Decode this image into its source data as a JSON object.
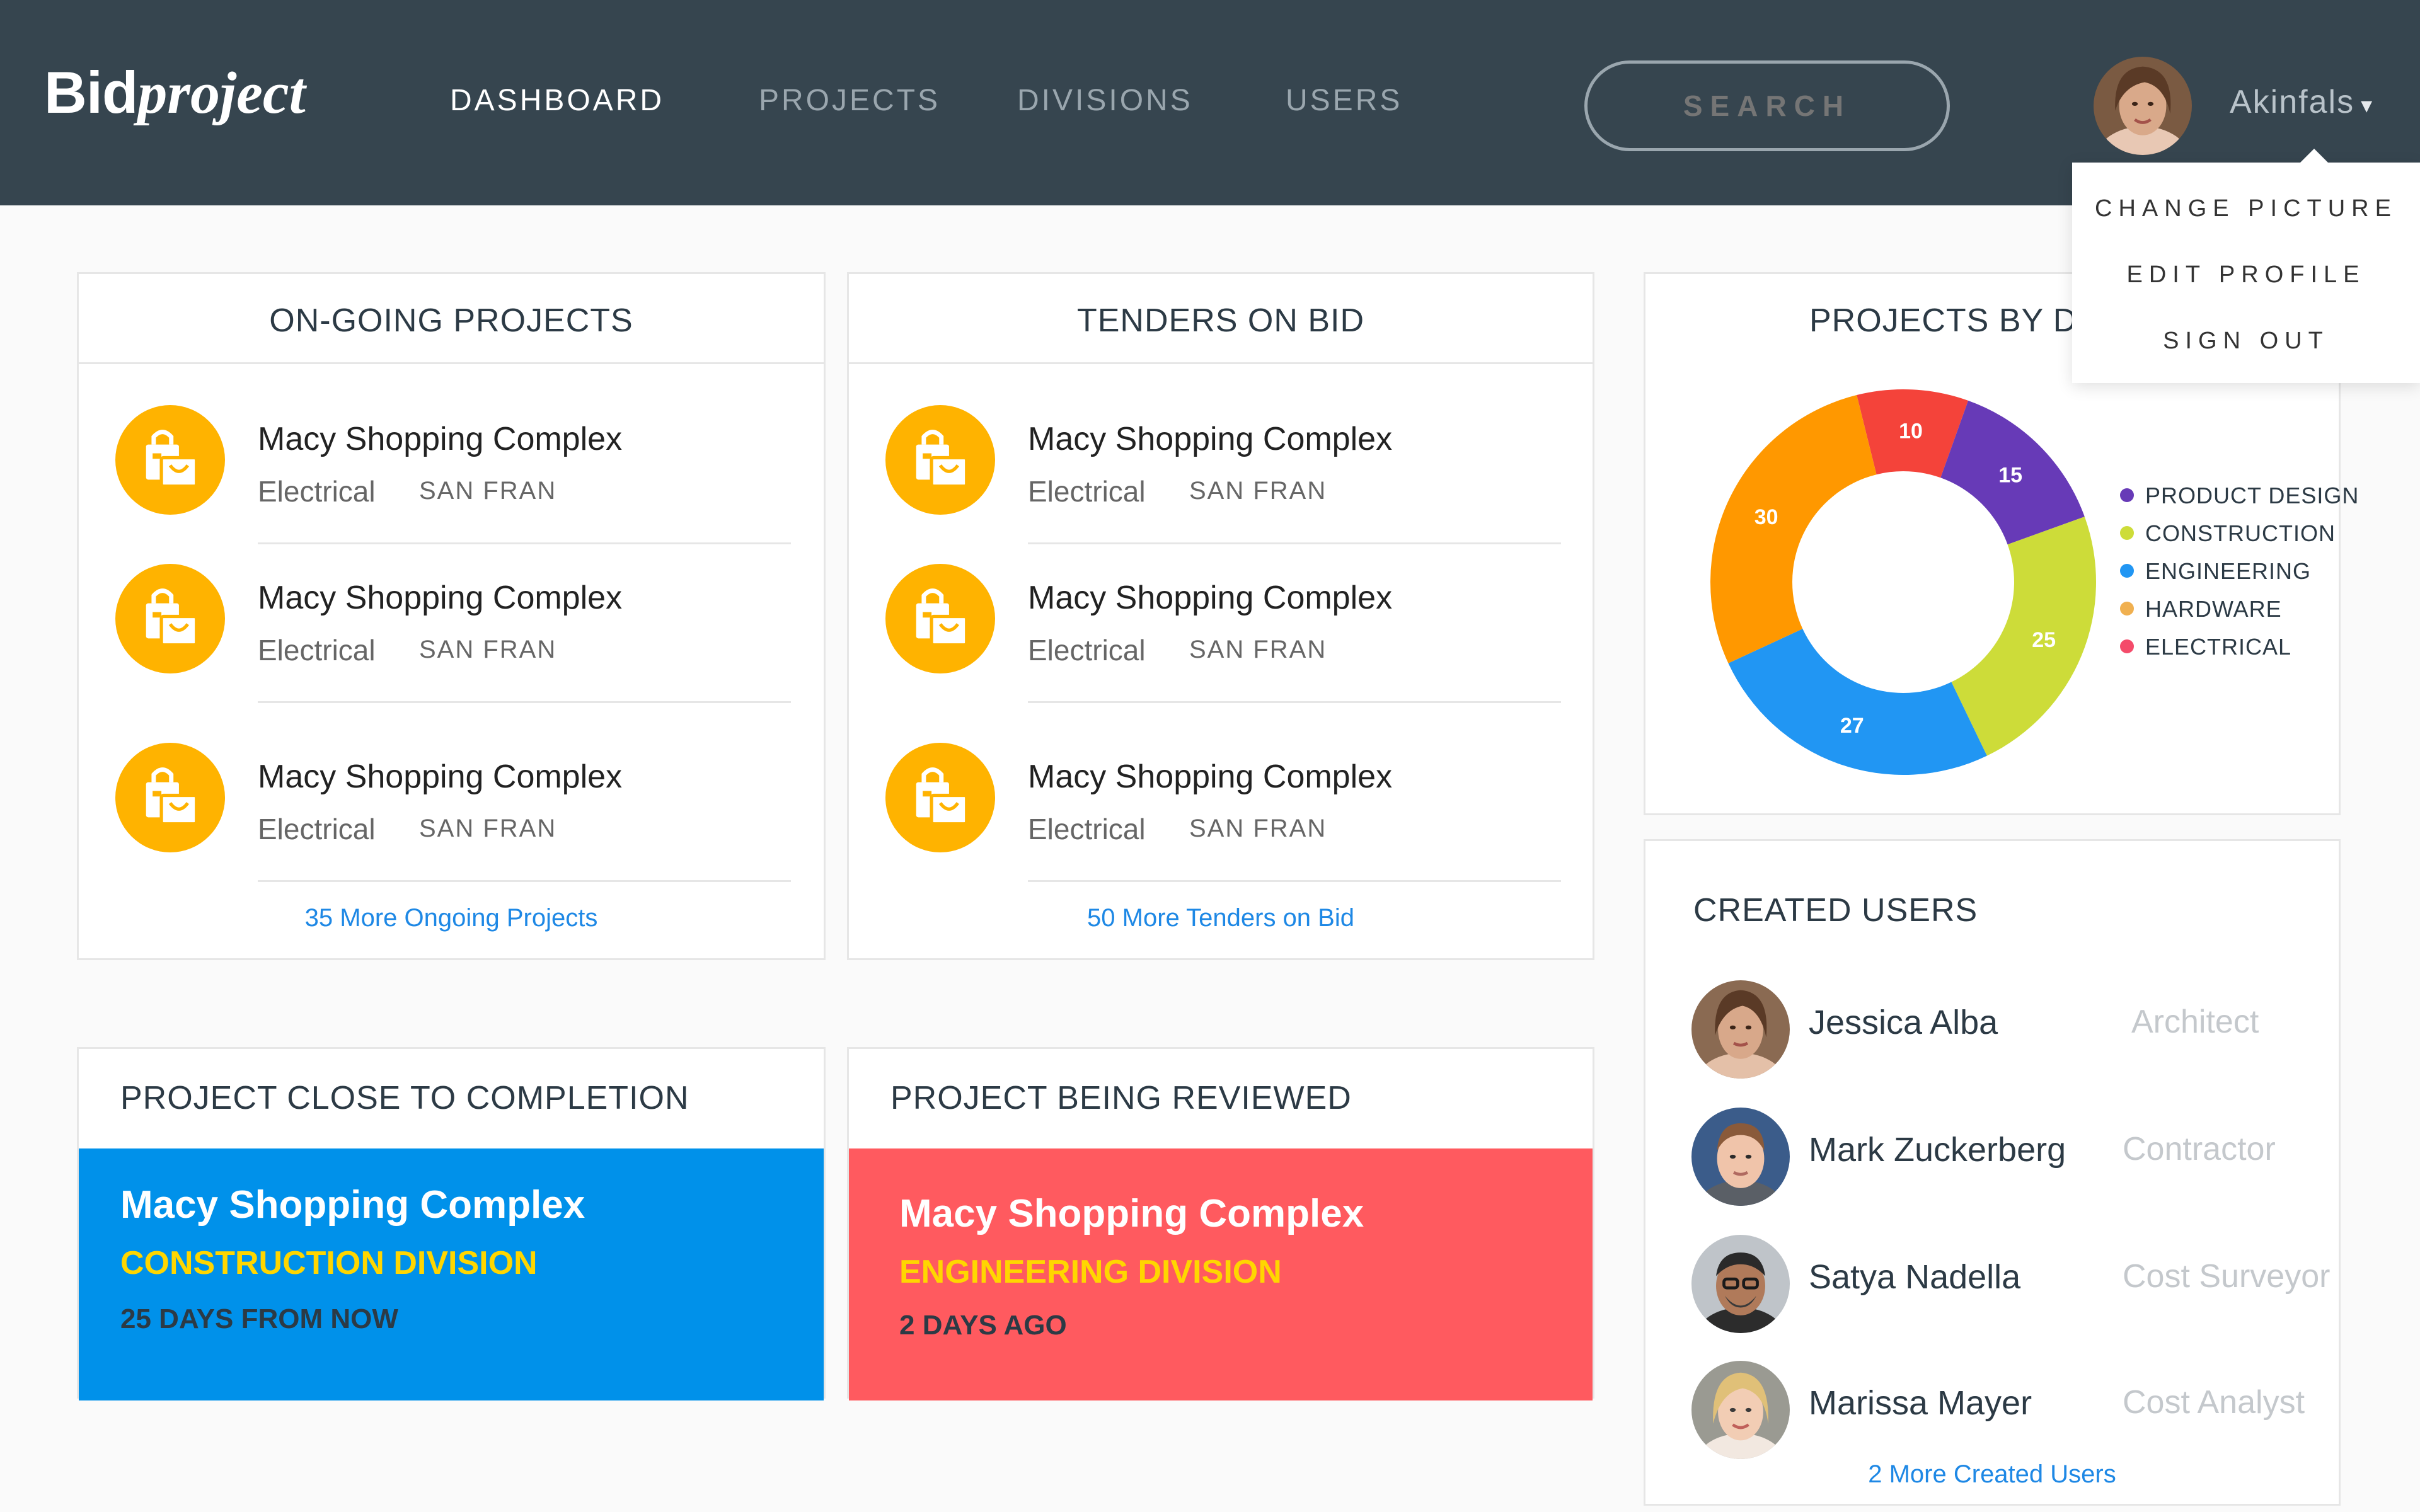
{
  "app": {
    "logo_bold": "Bid",
    "logo_italic": "project"
  },
  "nav": {
    "items": [
      {
        "label": "DASHBOARD",
        "active": true
      },
      {
        "label": "PROJECTS",
        "active": false
      },
      {
        "label": "DIVISIONS",
        "active": false
      },
      {
        "label": "USERS",
        "active": false
      }
    ]
  },
  "search": {
    "placeholder": "SEARCH"
  },
  "user_menu": {
    "name": "Akinfals",
    "caret": "▾",
    "items": [
      "CHANGE PICTURE",
      "EDIT PROFILE",
      "SIGN OUT"
    ]
  },
  "ongoing": {
    "title": "ON-GOING PROJECTS",
    "projects": [
      {
        "name": "Macy Shopping Complex",
        "category": "Electrical",
        "location": "SAN FRAN"
      },
      {
        "name": "Macy Shopping Complex",
        "category": "Electrical",
        "location": "SAN FRAN"
      },
      {
        "name": "Macy Shopping Complex",
        "category": "Electrical",
        "location": "SAN FRAN"
      }
    ],
    "more_link": "35 More Ongoing Projects"
  },
  "tenders": {
    "title": "TENDERS ON BID",
    "projects": [
      {
        "name": "Macy Shopping Complex",
        "category": "Electrical",
        "location": "SAN FRAN"
      },
      {
        "name": "Macy Shopping Complex",
        "category": "Electrical",
        "location": "SAN FRAN"
      },
      {
        "name": "Macy Shopping Complex",
        "category": "Electrical",
        "location": "SAN FRAN"
      }
    ],
    "more_link": "50 More Tenders on Bid"
  },
  "completion": {
    "title": "PROJECT CLOSE TO COMPLETION",
    "project": "Macy Shopping Complex",
    "division": "CONSTRUCTION DIVISION",
    "when": "25 DAYS FROM NOW",
    "color": "#0091ea"
  },
  "reviewed": {
    "title": "PROJECT BEING REVIEWED",
    "project": "Macy Shopping Complex",
    "division": "ENGINEERING DIVISION",
    "when": "2 DAYS AGO",
    "color": "#ff5a5f"
  },
  "division_chart": {
    "title": "PROJECTS BY D"
  },
  "chart_data": {
    "type": "pie",
    "donut": true,
    "slices": [
      {
        "value": 10,
        "color": "#f4433a"
      },
      {
        "value": 15,
        "color": "#673ab7"
      },
      {
        "value": 25,
        "color": "#cddc39"
      },
      {
        "value": 27,
        "color": "#2196f3"
      },
      {
        "value": 30,
        "color": "#ff9800"
      }
    ],
    "legend": [
      {
        "label": "PRODUCT DESIGN",
        "color": "#673ab7"
      },
      {
        "label": "CONSTRUCTION",
        "color": "#cddc39"
      },
      {
        "label": "ENGINEERING",
        "color": "#2196f3"
      },
      {
        "label": "HARDWARE",
        "color": "#f0b050"
      },
      {
        "label": "ELECTRICAL",
        "color": "#f44b6a"
      }
    ],
    "legend_placement": "right"
  },
  "created_users": {
    "title": "CREATED USERS",
    "users": [
      {
        "name": "Jessica Alba",
        "role": "Architect"
      },
      {
        "name": "Mark Zuckerberg",
        "role": "Contractor"
      },
      {
        "name": "Satya Nadella",
        "role": "Cost Surveyor"
      },
      {
        "name": "Marissa Mayer",
        "role": "Cost Analyst"
      }
    ],
    "more_link": "2 More Created Users"
  },
  "colors": {
    "header": "#36454f",
    "icon_bg": "#ffb300",
    "link": "#1e88e5",
    "division_highlight": "#ffd600"
  },
  "icons": {
    "project": "shopping-bags-icon",
    "caret": "chevron-down-icon"
  }
}
